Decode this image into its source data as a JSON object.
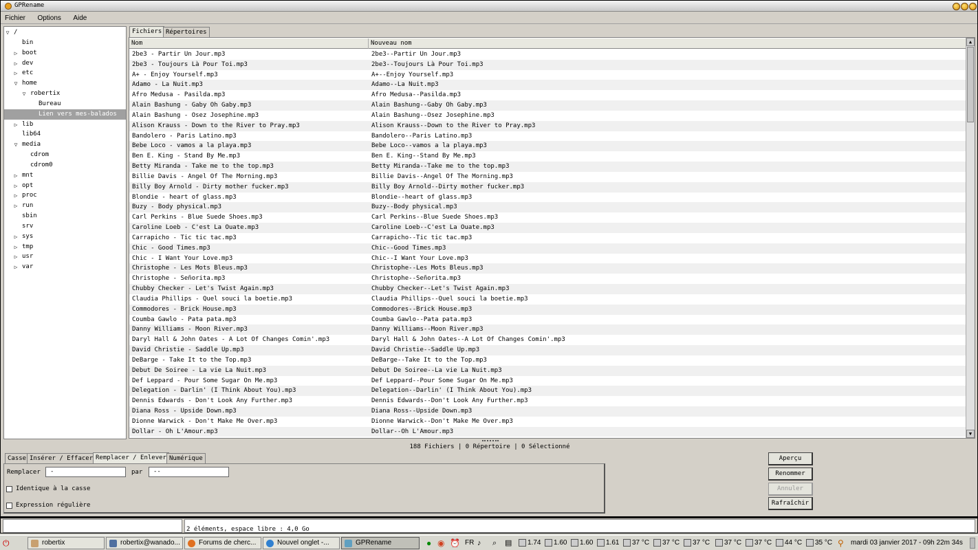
{
  "window": {
    "title": "GPRename"
  },
  "menu": [
    "Fichier",
    "Options",
    "Aide"
  ],
  "tree": [
    {
      "label": "/",
      "level": 0,
      "arrow": "open"
    },
    {
      "label": "bin",
      "level": 1,
      "arrow": "none"
    },
    {
      "label": "boot",
      "level": 1,
      "arrow": "closed"
    },
    {
      "label": "dev",
      "level": 1,
      "arrow": "closed"
    },
    {
      "label": "etc",
      "level": 1,
      "arrow": "closed"
    },
    {
      "label": "home",
      "level": 1,
      "arrow": "open"
    },
    {
      "label": "robertix",
      "level": 2,
      "arrow": "open"
    },
    {
      "label": "Bureau",
      "level": 3,
      "arrow": "none"
    },
    {
      "label": "Lien vers mes-balados",
      "level": 3,
      "arrow": "none",
      "selected": true
    },
    {
      "label": "lib",
      "level": 1,
      "arrow": "closed"
    },
    {
      "label": "lib64",
      "level": 1,
      "arrow": "none"
    },
    {
      "label": "media",
      "level": 1,
      "arrow": "open"
    },
    {
      "label": "cdrom",
      "level": 2,
      "arrow": "none"
    },
    {
      "label": "cdrom0",
      "level": 2,
      "arrow": "none"
    },
    {
      "label": "mnt",
      "level": 1,
      "arrow": "closed"
    },
    {
      "label": "opt",
      "level": 1,
      "arrow": "closed"
    },
    {
      "label": "proc",
      "level": 1,
      "arrow": "closed"
    },
    {
      "label": "run",
      "level": 1,
      "arrow": "closed"
    },
    {
      "label": "sbin",
      "level": 1,
      "arrow": "none"
    },
    {
      "label": "srv",
      "level": 1,
      "arrow": "none"
    },
    {
      "label": "sys",
      "level": 1,
      "arrow": "closed"
    },
    {
      "label": "tmp",
      "level": 1,
      "arrow": "closed"
    },
    {
      "label": "usr",
      "level": 1,
      "arrow": "closed"
    },
    {
      "label": "var",
      "level": 1,
      "arrow": "closed"
    }
  ],
  "top_tabs": [
    "Fichiers",
    "Répertoires"
  ],
  "columns": [
    "Nom",
    "Nouveau nom"
  ],
  "files": [
    [
      "2be3 - Partir Un Jour.mp3",
      "2be3--Partir Un Jour.mp3"
    ],
    [
      "2be3 - Toujours Là Pour Toi.mp3",
      "2be3--Toujours Là Pour Toi.mp3"
    ],
    [
      "A+ - Enjoy Yourself.mp3",
      "A+--Enjoy Yourself.mp3"
    ],
    [
      "Adamo - La Nuit.mp3",
      "Adamo--La Nuit.mp3"
    ],
    [
      "Afro Medusa - Pasilda.mp3",
      "Afro Medusa--Pasilda.mp3"
    ],
    [
      "Alain Bashung - Gaby Oh Gaby.mp3",
      "Alain Bashung--Gaby Oh Gaby.mp3"
    ],
    [
      "Alain Bashung - Osez Josephine.mp3",
      "Alain Bashung--Osez Josephine.mp3"
    ],
    [
      "Alison Krauss - Down to the River to Pray.mp3",
      "Alison Krauss--Down to the River to Pray.mp3"
    ],
    [
      "Bandolero - Paris Latino.mp3",
      "Bandolero--Paris Latino.mp3"
    ],
    [
      "Bebe Loco - vamos a la playa.mp3",
      "Bebe Loco--vamos a la playa.mp3"
    ],
    [
      "Ben E. King - Stand By Me.mp3",
      "Ben E. King--Stand By Me.mp3"
    ],
    [
      "Betty Miranda - Take me to the top.mp3",
      "Betty Miranda--Take me to the top.mp3"
    ],
    [
      "Billie Davis - Angel Of The Morning.mp3",
      "Billie Davis--Angel Of The Morning.mp3"
    ],
    [
      "Billy Boy Arnold - Dirty mother fucker.mp3",
      "Billy Boy Arnold--Dirty mother fucker.mp3"
    ],
    [
      "Blondie - heart of glass.mp3",
      "Blondie--heart of glass.mp3"
    ],
    [
      "Buzy - Body physical.mp3",
      "Buzy--Body physical.mp3"
    ],
    [
      "Carl Perkins - Blue Suede Shoes.mp3",
      "Carl Perkins--Blue Suede Shoes.mp3"
    ],
    [
      "Caroline Loeb - C'est La Ouate.mp3",
      "Caroline Loeb--C'est La Ouate.mp3"
    ],
    [
      "Carrapicho - Tic tic tac.mp3",
      "Carrapicho--Tic tic tac.mp3"
    ],
    [
      "Chic - Good Times.mp3",
      "Chic--Good Times.mp3"
    ],
    [
      "Chic - I Want Your Love.mp3",
      "Chic--I Want Your Love.mp3"
    ],
    [
      "Christophe - Les Mots Bleus.mp3",
      "Christophe--Les Mots Bleus.mp3"
    ],
    [
      "Christophe - Señorita.mp3",
      "Christophe--Señorita.mp3"
    ],
    [
      "Chubby Checker - Let's Twist Again.mp3",
      "Chubby Checker--Let's Twist Again.mp3"
    ],
    [
      "Claudia Phillips - Quel souci la boetie.mp3",
      "Claudia Phillips--Quel souci la boetie.mp3"
    ],
    [
      "Commodores - Brick House.mp3",
      "Commodores--Brick House.mp3"
    ],
    [
      "Coumba Gawlo - Pata pata.mp3",
      "Coumba Gawlo--Pata pata.mp3"
    ],
    [
      "Danny Williams - Moon River.mp3",
      "Danny Williams--Moon River.mp3"
    ],
    [
      "Daryl Hall & John Oates - A Lot Of Changes Comin'.mp3",
      "Daryl Hall & John Oates--A Lot Of Changes Comin'.mp3"
    ],
    [
      "David Christie - Saddle Up.mp3",
      "David Christie--Saddle Up.mp3"
    ],
    [
      "DeBarge - Take It to the Top.mp3",
      "DeBarge--Take It to the Top.mp3"
    ],
    [
      "Debut De Soiree - La vie La Nuit.mp3",
      "Debut De Soiree--La vie La Nuit.mp3"
    ],
    [
      "Def Leppard - Pour Some Sugar On Me.mp3",
      "Def Leppard--Pour Some Sugar On Me.mp3"
    ],
    [
      "Delegation - Darlin' (I Think About You).mp3",
      "Delegation--Darlin' (I Think About You).mp3"
    ],
    [
      "Dennis Edwards - Don't Look Any Further.mp3",
      "Dennis Edwards--Don't Look Any Further.mp3"
    ],
    [
      "Diana Ross - Upside Down.mp3",
      "Diana Ross--Upside Down.mp3"
    ],
    [
      "Dionne Warwick - Don't Make Me Over.mp3",
      "Dionne Warwick--Don't Make Me Over.mp3"
    ],
    [
      "Dollar - Oh L'Amour.mp3",
      "Dollar--Oh L'Amour.mp3"
    ]
  ],
  "count_status": "188 Fichiers | 0 Répertoire | 0 Sélectionné",
  "bottom_tabs": [
    "Casse",
    "Insérer / Effacer",
    "Remplacer / Enlever",
    "Numérique"
  ],
  "replace": {
    "label": "Remplacer",
    "value": " -",
    "by_label": "par",
    "by_value": "--",
    "case_label": "Identique à la casse",
    "regex_label": "Expression régulière"
  },
  "buttons": {
    "preview": "Aperçu",
    "rename": "Renommer",
    "cancel": "Annuler",
    "refresh": "Rafraîchir"
  },
  "status_bar": "2 éléments, espace libre : 4,0 Go",
  "taskbar": {
    "tasks": [
      "robertix",
      "robertix@wanado...",
      "Forums de cherc...",
      "Nouvel onglet -...",
      "GPRename"
    ],
    "lang": "FR",
    "loads": [
      "1.74",
      "1.60",
      "1.60",
      "1.61"
    ],
    "temps": [
      "37 °C",
      "37 °C",
      "37 °C",
      "37 °C",
      "37 °C",
      "44 °C",
      "35 °C"
    ],
    "clock": "mardi 03 janvier 2017 - 09h 22m 34s"
  },
  "colors": {
    "selection": "#a0a0a0",
    "window_bg": "#d4d0c8",
    "title_button": "#e8a020"
  }
}
